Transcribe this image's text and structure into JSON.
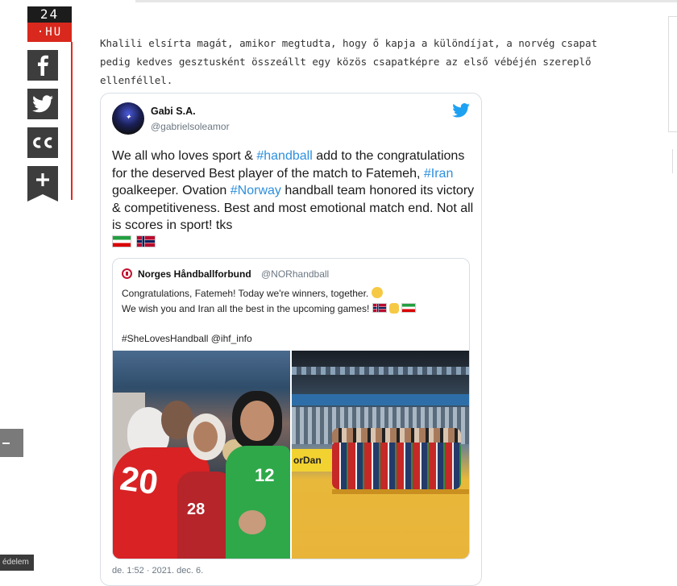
{
  "site": {
    "logo_top": "24",
    "logo_bottom": "·HU",
    "cookie_text": "édelem"
  },
  "share": {
    "buttons": [
      "facebook-icon",
      "twitter-icon",
      "cc-icon",
      "plus-icon"
    ]
  },
  "article": {
    "paragraph": "Khalili elsírta magát, amikor megtudta, hogy ő kapja a különdíjat, a norvég csapat pedig kedves gesztusként összeállt egy közös csapatképre az első vébéjén szereplő ellenféllel."
  },
  "tweet": {
    "name": "Gabi S.A.",
    "handle": "@gabrielsoleamor",
    "text_1": "We all who loves sport & ",
    "tag_1": "#handball",
    "text_2": " add to the congratulations for the deserved Best player of the match to Fatemeh, ",
    "tag_2": "#Iran",
    "text_3": " goalkeeper.  Ovation ",
    "tag_3": "#Norway",
    "text_4": " handball team honored its victory & competitiveness. Best and most emotional match end. Not all is scores in sport! tks",
    "date": "de. 1:52 · 2021. dec. 6.",
    "quote": {
      "name": "Norges Håndballforbund",
      "handle": "@NORhandball",
      "line_1": "Congratulations, Fatemeh!  Today we're winners, together.",
      "line_2": "We wish you and Iran all the best in the upcoming games!",
      "line_3": "#SheLovesHandball @ihf_info",
      "jersey_number_1": "20",
      "jersey_number_2": "12",
      "jersey_number_3": "28",
      "banner_text": "orDan"
    }
  },
  "colors": {
    "accent_red": "#d9281d",
    "twitter_blue": "#1da1f2",
    "hashtag": "#2d8fdd"
  }
}
